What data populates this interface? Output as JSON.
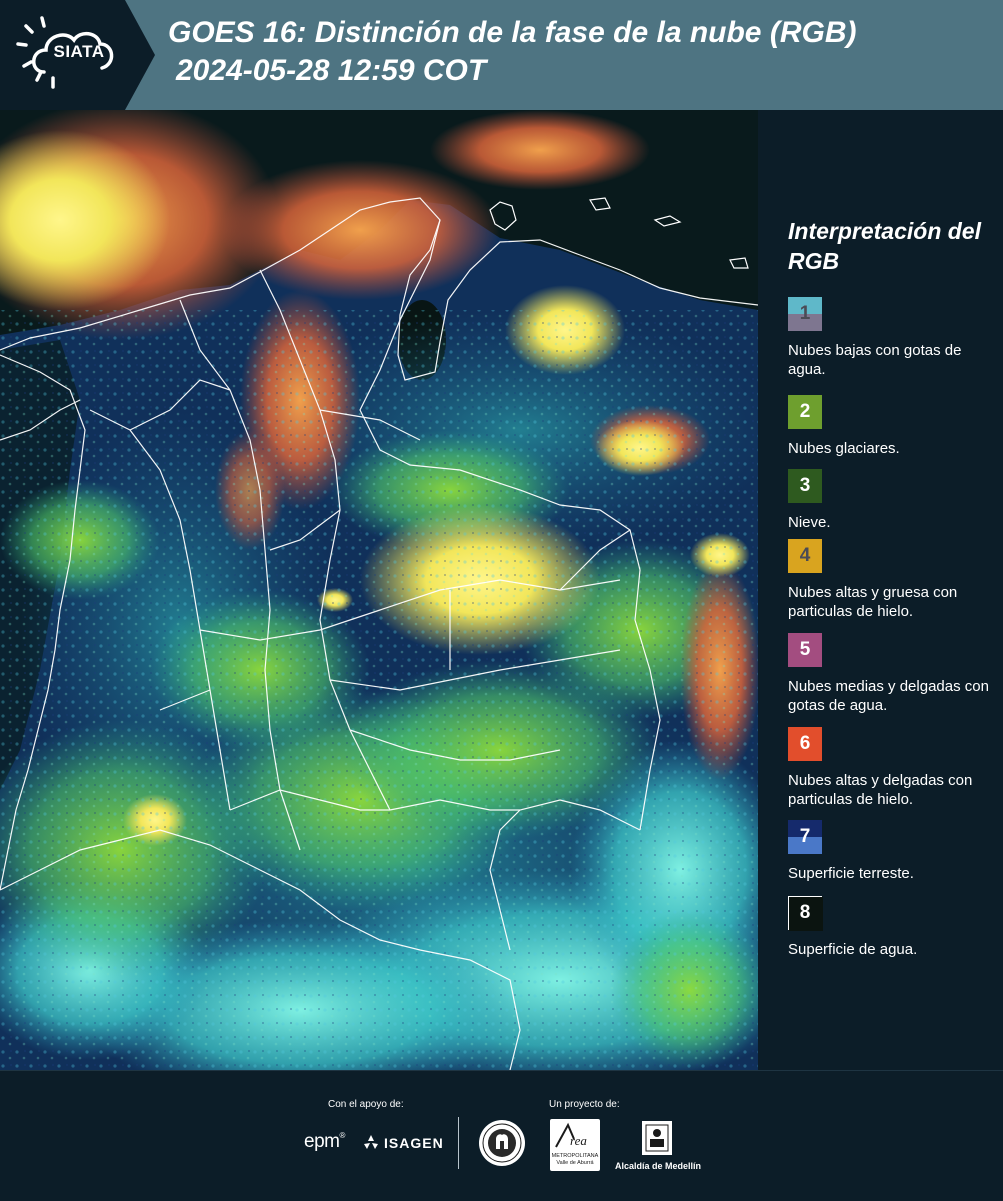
{
  "header": {
    "logo_text": "SIATA",
    "title_line1": "GOES 16: Distinción de la fase de la nube (RGB)",
    "title_line2": "2024-05-28 12:59 COT",
    "background": "#4e7482"
  },
  "map": {
    "icon": "satellite-composite-map"
  },
  "legend": {
    "title": "Interpretación del RGB",
    "items": [
      {
        "number": "1",
        "label": "Nubes bajas con gotas de agua.",
        "color_top": "#5fb8c9",
        "color_bottom": "#7e7690",
        "number_color": "#4b4b55"
      },
      {
        "number": "2",
        "label": "Nubes glaciares.",
        "color_top": "#6e9f2e",
        "color_bottom": "#6e9f2e",
        "number_color": "#ffffff"
      },
      {
        "number": "3",
        "label": "Nieve.",
        "color_top": "#2e5a1f",
        "color_bottom": "#2e5a1f",
        "number_color": "#ffffff"
      },
      {
        "number": "4",
        "label": "Nubes altas y gruesa con particulas de hielo.",
        "color_top": "#d9a41f",
        "color_bottom": "#d9a41f",
        "number_color": "#4b4b55"
      },
      {
        "number": "5",
        "label": "Nubes medias y delgadas con gotas de agua.",
        "color_top": "#a34d80",
        "color_bottom": "#a34d80",
        "number_color": "#ffffff"
      },
      {
        "number": "6",
        "label": "Nubes altas y delgadas con particulas de hielo.",
        "color_top": "#e24e2c",
        "color_bottom": "#e24e2c",
        "number_color": "#ffffff"
      },
      {
        "number": "7",
        "label": "Superficie terreste.",
        "color_top": "#152a6c",
        "color_bottom": "#4a78c8",
        "number_color": "#ffffff"
      },
      {
        "number": "8",
        "label": "Superficie de agua.",
        "color_top": "#0b1410",
        "color_bottom": "#0b1410",
        "number_color": "#ffffff"
      }
    ]
  },
  "footer": {
    "support_label": "Con el apoyo de:",
    "project_label": "Un proyecto de:",
    "epm_text": "epm",
    "isagen_text": "ISAGEN",
    "area_text": "Área",
    "area_sub": "METROPOLITANA Valle de Aburrá",
    "medellin_text": "Alcaldía de Medellín"
  }
}
